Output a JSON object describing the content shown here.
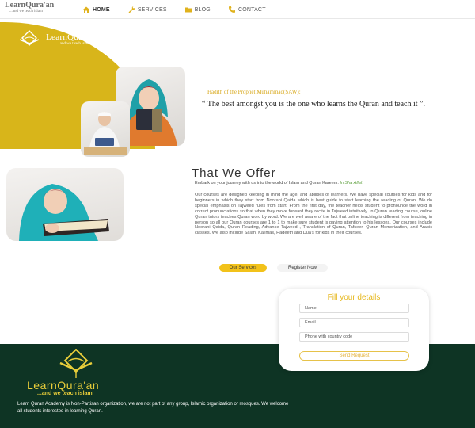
{
  "brand": {
    "title": "LearnQura'an",
    "subtitle": "...and we teach islam"
  },
  "nav": [
    {
      "label": "HOME",
      "icon": "home-icon"
    },
    {
      "label": "SERVICES",
      "icon": "wrench-icon"
    },
    {
      "label": "BLOG",
      "icon": "folder-icon"
    },
    {
      "label": "CONTACT",
      "icon": "phone-icon"
    }
  ],
  "hero": {
    "logo_title": "LearnQura`an",
    "logo_subtitle": "...and we teach islam",
    "hadith_title": "Hadith of the Prophet Muhammad(SAW):",
    "hadith_quote": "“ The best amongst you is the one who learns the Quran and teach it ”."
  },
  "offer": {
    "title": "That We Offer",
    "intro": "Embark on your journey with us into the world of Islam and Quran Kareem.",
    "intro_accent": "In Sha Allah",
    "body": "Our courses are designed keeping in mind the age, and abilities of learners. We have special courses for kids and for beginners in which they start from Noorani Qaida which is best guide to start learning the reading of Quran. We do special emphasis on Tajweed rules from start. From the first day, the teacher helps student to pronounce the word in correct pronunciations so that when they move forward they recite in Tajweed intuitively. In Quran reading course, online Quran tutors teaches Quran word by word. We are well aware of the fact that online teaching is different from teaching in person so all our Quran courses are 1 to 1 to make sure student is paying attention to his lessons. Our courses include Noorani Qaida, Quran Reading, Advance Tajweed , Translation of Quran, Tafseer, Quran Memorization, and Arabic classes. We also include Salah, Kalimas, Hadeeth and Dua's for kids in their courses.",
    "services_button": "Our Services",
    "register_button": "Register Now"
  },
  "form": {
    "title": "Fill your details",
    "name_placeholder": "Name",
    "email_placeholder": "Email",
    "phone_placeholder": "Phone with country code",
    "send_button": "Send Request"
  },
  "footer": {
    "title": "LearnQura'an",
    "subtitle": "...and we teach islam",
    "text": "Learn Quran Academy is Non-Partisan organization, we are not part of any group, Islamic organization or mosques. We welcome all students interested in learning Quran."
  },
  "colors": {
    "accent_gold": "#d8b51a",
    "footer_green": "#0e3424",
    "button_yellow": "#f2c21a"
  }
}
